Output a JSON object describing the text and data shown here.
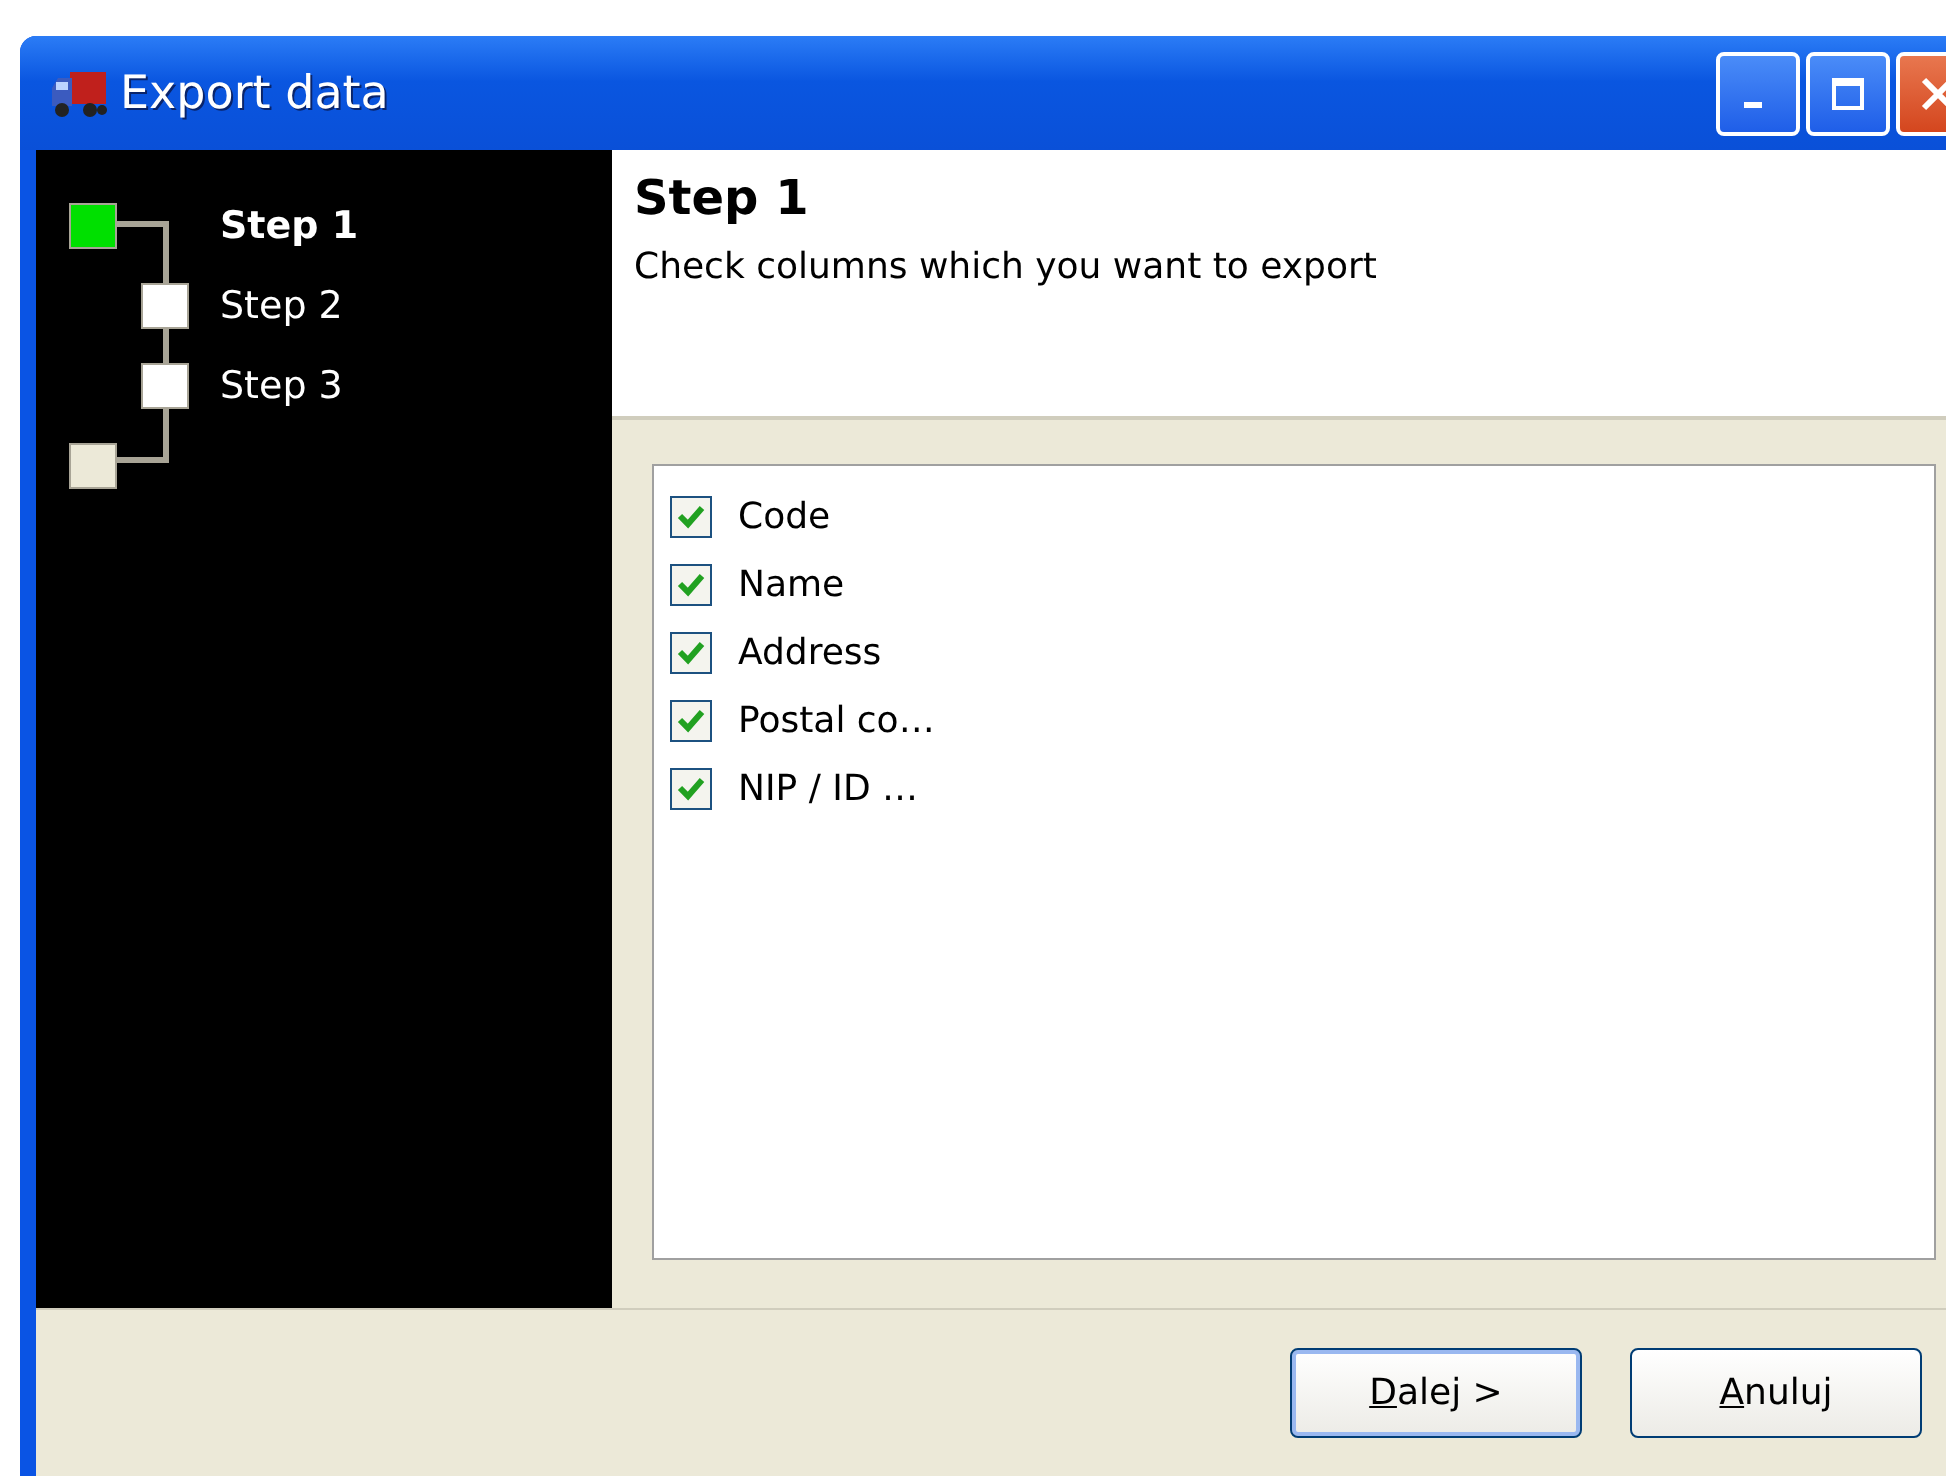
{
  "window": {
    "title": "Export data"
  },
  "steps": [
    {
      "label": "Step 1",
      "selected": true
    },
    {
      "label": "Step 2",
      "selected": false
    },
    {
      "label": "Step 3",
      "selected": false
    }
  ],
  "header": {
    "title": "Step 1",
    "subtitle": "Check columns which you want to export"
  },
  "columns": [
    {
      "label": "Code",
      "checked": true
    },
    {
      "label": "Name",
      "checked": true
    },
    {
      "label": "Address",
      "checked": true
    },
    {
      "label": "Postal co…",
      "checked": true
    },
    {
      "label": "NIP / ID …",
      "checked": true
    }
  ],
  "buttons": [
    {
      "label": "Dalej >",
      "kind": "default"
    },
    {
      "label": "Anuluj",
      "kind": "normal"
    }
  ]
}
